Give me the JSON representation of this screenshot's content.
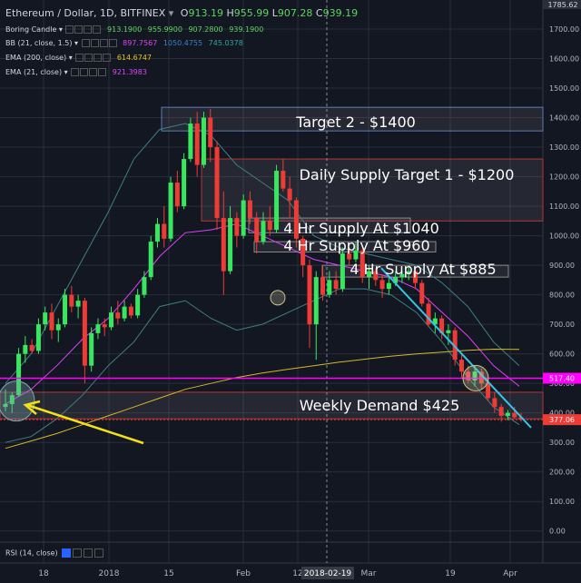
{
  "header": {
    "symbol": "Ethereum / Dollar, 1D, BITFINEX",
    "dropdown_icon": "caret-down-icon",
    "ohlc": {
      "o_label": "O",
      "o": "913.19",
      "h_label": "H",
      "h": "955.99",
      "l_label": "L",
      "l": "907.28",
      "c_label": "C",
      "c": "939.19"
    }
  },
  "indicators": [
    {
      "name": "Boring Candle",
      "values": [
        "913.1900",
        "955.9900",
        "907.2800",
        "939.1900"
      ],
      "color": "#5fd35f"
    },
    {
      "name": "BB (21, close, 1.5)",
      "values": [
        "897.7567",
        "1050.4755",
        "745.0378"
      ],
      "colors": [
        "#d946ef",
        "#3b82c4",
        "#2fa3a3"
      ]
    },
    {
      "name": "EMA (200, close)",
      "values": [
        "614.6747"
      ],
      "color": "#e3c21f"
    },
    {
      "name": "EMA (21, close)",
      "values": [
        "921.3983"
      ],
      "color": "#d946ef"
    }
  ],
  "rsi": {
    "label": "RSI (14, close)"
  },
  "colors": {
    "background": "#131722",
    "grid": "#2a2e39",
    "bull": "#39e75f",
    "bear": "#ef3b36",
    "ema200": "#d4b82a",
    "ema21": "#e040fb",
    "bb": "#3f7f84",
    "support": "#ff00ff",
    "price_line": "#ef3b36",
    "trend": "#35c4e6",
    "arrow": "#f4e01a"
  },
  "chart_data": {
    "type": "candlestick",
    "y_axis": {
      "ticks": [
        "1700.00",
        "1600.00",
        "1500.00",
        "1400.00",
        "1300.00",
        "1200.00",
        "1100.00",
        "1000.00",
        "900.00",
        "800.00",
        "700.00",
        "600.00",
        "500.00",
        "400.00",
        "300.00",
        "200.00",
        "100.00",
        "0.00"
      ],
      "top_label": "1785.62",
      "ylim": [
        -30,
        1820
      ]
    },
    "x_axis": {
      "ticks": [
        "18",
        "2018",
        "15",
        "Feb",
        "12",
        "Mar",
        "19",
        "Apr"
      ],
      "crosshair_label": "2018-02-19"
    },
    "price_labels": [
      {
        "value": 517.4,
        "text": "517.40",
        "color": "#ff00ff"
      },
      {
        "value": 377.06,
        "text": "377.06",
        "color": "#ef3b36"
      }
    ],
    "zones": [
      {
        "label": "Target 2 - $1400",
        "from": 1355,
        "to": 1435,
        "edge": "#5b7db3"
      },
      {
        "label": "Daily Supply Target 1 - $1200",
        "from": 1050,
        "to": 1260,
        "edge": "#b33636"
      },
      {
        "label": "4 Hr Supply At $1040",
        "from": 1010,
        "to": 1060,
        "edge": "#8a8a8a"
      },
      {
        "label": "4 Hr Supply At $960",
        "from": 945,
        "to": 980,
        "edge": "#8a8a8a"
      },
      {
        "label": "4 Hr Supply At $885",
        "from": 860,
        "to": 900,
        "edge": "#8a8a8a"
      },
      {
        "label": "Weekly Demand $425",
        "from": 380,
        "to": 470,
        "edge": "#b33636"
      }
    ],
    "annotations": [
      {
        "type": "circle",
        "near": "first-candles",
        "value": 440
      },
      {
        "type": "circle",
        "near": "mar-retest",
        "value": 518
      },
      {
        "type": "circle",
        "near": "feb-low",
        "value": 790
      },
      {
        "type": "arrow",
        "points_to": "weekly-demand"
      },
      {
        "type": "trendline",
        "from": 890,
        "to": 360
      }
    ],
    "candles": [
      [
        420,
        480,
        405,
        430
      ],
      [
        430,
        470,
        400,
        460
      ],
      [
        460,
        620,
        455,
        600
      ],
      [
        600,
        660,
        570,
        630
      ],
      [
        630,
        650,
        600,
        610
      ],
      [
        610,
        720,
        600,
        700
      ],
      [
        700,
        760,
        680,
        740
      ],
      [
        740,
        770,
        650,
        680
      ],
      [
        680,
        720,
        640,
        700
      ],
      [
        700,
        820,
        690,
        800
      ],
      [
        800,
        830,
        740,
        760
      ],
      [
        760,
        800,
        720,
        780
      ],
      [
        780,
        790,
        500,
        560
      ],
      [
        560,
        690,
        540,
        670
      ],
      [
        670,
        720,
        650,
        700
      ],
      [
        700,
        720,
        660,
        690
      ],
      [
        690,
        760,
        680,
        740
      ],
      [
        740,
        780,
        700,
        720
      ],
      [
        720,
        780,
        710,
        760
      ],
      [
        760,
        770,
        720,
        730
      ],
      [
        730,
        820,
        720,
        800
      ],
      [
        800,
        880,
        790,
        860
      ],
      [
        860,
        1000,
        850,
        980
      ],
      [
        980,
        1060,
        960,
        1040
      ],
      [
        1040,
        1100,
        960,
        990
      ],
      [
        990,
        1200,
        980,
        1180
      ],
      [
        1180,
        1220,
        1080,
        1100
      ],
      [
        1100,
        1280,
        1090,
        1260
      ],
      [
        1260,
        1400,
        1250,
        1380
      ],
      [
        1380,
        1420,
        1200,
        1240
      ],
      [
        1240,
        1420,
        1230,
        1400
      ],
      [
        1400,
        1430,
        1250,
        1300
      ],
      [
        1300,
        1320,
        1020,
        1060
      ],
      [
        1060,
        1150,
        800,
        880
      ],
      [
        880,
        1100,
        870,
        1060
      ],
      [
        1060,
        1080,
        960,
        1000
      ],
      [
        1000,
        1140,
        990,
        1120
      ],
      [
        1120,
        1150,
        1040,
        1060
      ],
      [
        1060,
        1080,
        940,
        980
      ],
      [
        980,
        1080,
        970,
        1050
      ],
      [
        1050,
        1100,
        1000,
        1020
      ],
      [
        1020,
        1240,
        1010,
        1220
      ],
      [
        1220,
        1260,
        1150,
        1160
      ],
      [
        1160,
        1200,
        1060,
        1120
      ],
      [
        1120,
        1130,
        960,
        990
      ],
      [
        990,
        1000,
        860,
        900
      ],
      [
        900,
        920,
        620,
        700
      ],
      [
        700,
        880,
        580,
        860
      ],
      [
        860,
        900,
        780,
        800
      ],
      [
        800,
        880,
        790,
        850
      ],
      [
        850,
        880,
        800,
        820
      ],
      [
        820,
        960,
        810,
        940
      ],
      [
        940,
        960,
        900,
        920
      ],
      [
        920,
        980,
        910,
        950
      ],
      [
        950,
        960,
        840,
        860
      ],
      [
        860,
        900,
        820,
        880
      ],
      [
        880,
        890,
        830,
        850
      ],
      [
        850,
        870,
        790,
        820
      ],
      [
        820,
        860,
        800,
        840
      ],
      [
        840,
        880,
        830,
        860
      ],
      [
        860,
        880,
        840,
        870
      ],
      [
        870,
        900,
        850,
        880
      ],
      [
        880,
        885,
        820,
        840
      ],
      [
        840,
        850,
        760,
        770
      ],
      [
        770,
        790,
        690,
        700
      ],
      [
        700,
        740,
        670,
        720
      ],
      [
        720,
        730,
        650,
        670
      ],
      [
        670,
        700,
        630,
        680
      ],
      [
        680,
        690,
        560,
        580
      ],
      [
        580,
        600,
        520,
        540
      ],
      [
        540,
        560,
        500,
        510
      ],
      [
        510,
        560,
        490,
        540
      ],
      [
        540,
        550,
        480,
        500
      ],
      [
        500,
        520,
        440,
        450
      ],
      [
        450,
        470,
        400,
        420
      ],
      [
        420,
        430,
        370,
        390
      ],
      [
        390,
        410,
        375,
        400
      ],
      [
        400,
        420,
        380,
        385
      ],
      [
        385,
        400,
        370,
        377
      ]
    ],
    "ema200": [
      280,
      305,
      330,
      360,
      390,
      420,
      450,
      480,
      500,
      520,
      535,
      548,
      560,
      572,
      582,
      592,
      600,
      606,
      612,
      616,
      615
    ],
    "ema21": [
      430,
      480,
      560,
      650,
      720,
      820,
      930,
      1010,
      1020,
      1040,
      1000,
      960,
      920,
      900,
      880,
      860,
      820,
      740,
      660,
      560,
      490
    ],
    "bb_upper": [
      500,
      600,
      760,
      920,
      1080,
      1260,
      1360,
      1380,
      1340,
      1240,
      1180,
      1120,
      1000,
      960,
      940,
      920,
      900,
      840,
      760,
      640,
      560
    ],
    "bb_lower": [
      300,
      320,
      380,
      460,
      560,
      640,
      760,
      780,
      720,
      680,
      700,
      740,
      780,
      820,
      820,
      800,
      740,
      640,
      520,
      420,
      360
    ]
  }
}
